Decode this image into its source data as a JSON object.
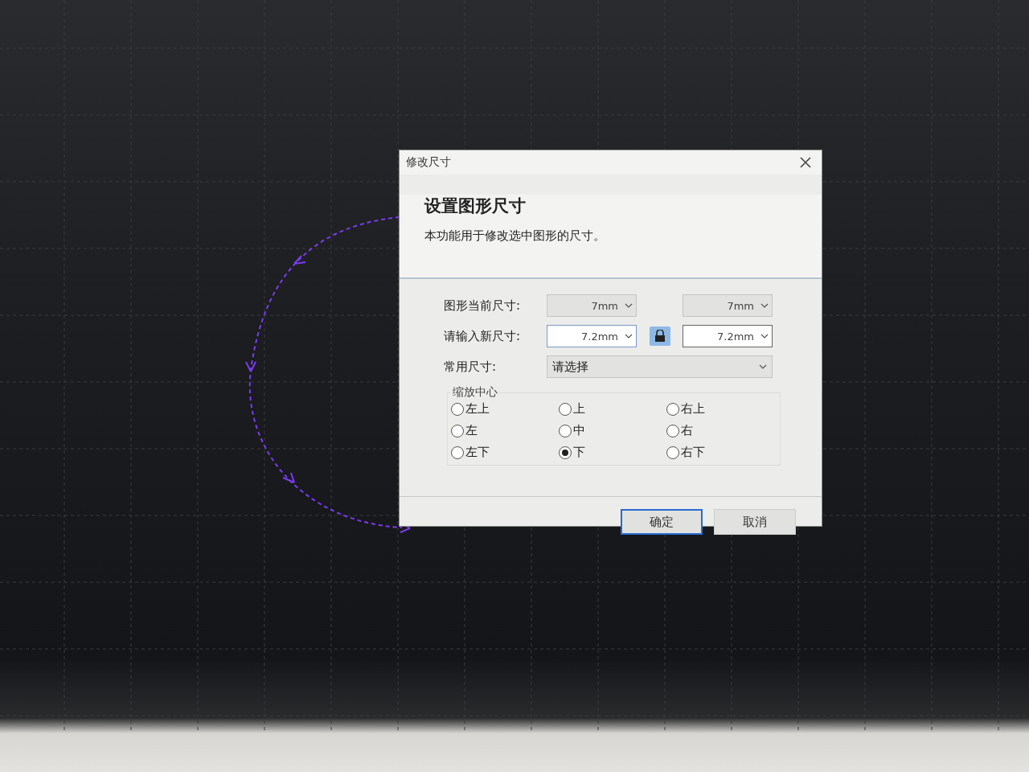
{
  "window": {
    "title": "修改尺寸"
  },
  "heading": "设置图形尺寸",
  "description": "本功能用于修改选中图形的尺寸。",
  "current_size": {
    "label": "图形当前尺寸:",
    "width": "7mm",
    "height": "7mm"
  },
  "new_size": {
    "label": "请输入新尺寸:",
    "width": "7.2mm",
    "height": "7.2mm",
    "locked": true
  },
  "common_size": {
    "label": "常用尺寸:",
    "value": "请选择"
  },
  "scale_center": {
    "label": "缩放中心",
    "options": [
      {
        "label": "左上",
        "selected": false
      },
      {
        "label": "上",
        "selected": false
      },
      {
        "label": "右上",
        "selected": false
      },
      {
        "label": "左",
        "selected": false
      },
      {
        "label": "中",
        "selected": false
      },
      {
        "label": "右",
        "selected": false
      },
      {
        "label": "左下",
        "selected": false
      },
      {
        "label": "下",
        "selected": true
      },
      {
        "label": "右下",
        "selected": false
      }
    ]
  },
  "buttons": [
    {
      "label": "确定",
      "default": true
    },
    {
      "label": "取消",
      "default": false
    }
  ]
}
